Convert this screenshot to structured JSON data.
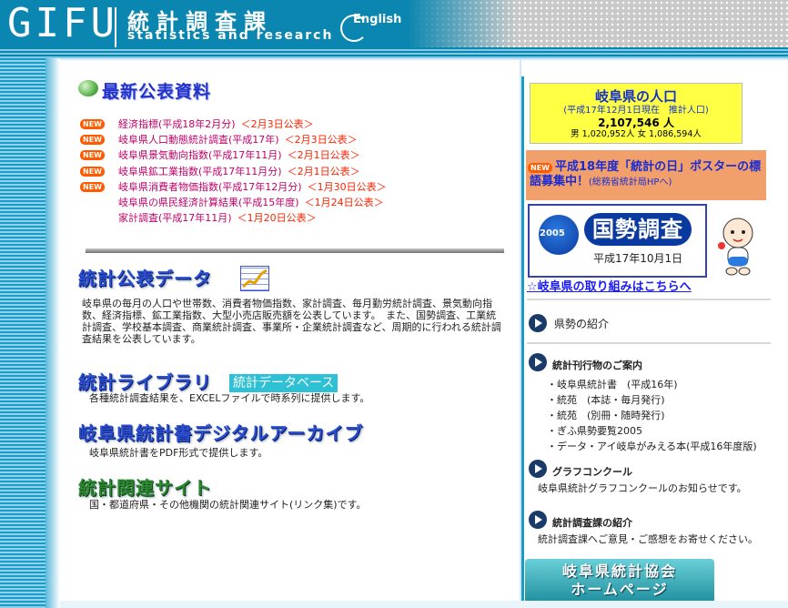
{
  "header": {
    "logo_gifu": "GIFU",
    "logo_jp": "統計調査課",
    "logo_en": "statistics and research",
    "english_label": "English"
  },
  "news": {
    "heading": "最新公表資料",
    "items": [
      {
        "badge": "NEW",
        "title": "経済指標(平成18年2月分)",
        "date": "＜2月3日公表＞"
      },
      {
        "badge": "NEW",
        "title": "岐阜県人口動態統計調査(平成17年)",
        "date": "＜2月3日公表＞"
      },
      {
        "badge": "NEW",
        "title": "岐阜県景気動向指数(平成17年11月)",
        "date": "＜2月1日公表＞"
      },
      {
        "badge": "NEW",
        "title": "岐阜県鉱工業指数(平成17年11月分)",
        "date": "＜2月1日公表＞"
      },
      {
        "badge": "NEW",
        "title": "岐阜県消費者物価指数(平成17年12月分)",
        "date": "＜1月30日公表＞"
      },
      {
        "badge": "",
        "title": "岐阜県の県民経済計算結果(平成15年度)",
        "date": "＜1月24日公表＞"
      },
      {
        "badge": "",
        "title": "家計調査(平成17年11月)",
        "date": "＜1月20日公表＞"
      }
    ]
  },
  "sections": {
    "stats": {
      "title": "統計公表データ",
      "text": "岐阜県の毎月の人口や世帯数、消費者物価指数、家計調査、毎月勤労統計調査、景気動向指数、経済指標、鉱工業指数、大型小売店販売額を公表しています。　また、国勢調査、工業統計調査、学校基本調査、商業統計調査、事業所・企業統計調査など、周期的に行われる統計調査結果を公表しています。"
    },
    "library": {
      "title": "統計ライブラリ",
      "db_label": "統計データベース",
      "text": "各種統計調査結果を、EXCELファイルで時系列に提供します。"
    },
    "archive": {
      "title": "岐阜県統計書デジタルアーカイブ",
      "text": "岐阜県統計書をPDF形式で提供します。"
    },
    "related": {
      "title": "統計関連サイト",
      "text": "国・都道府県・その他機関の統計関連サイト(リンク集)です。"
    }
  },
  "population": {
    "title": "岐阜県の人口",
    "date": "(平成17年12月1日現在　推計人口)",
    "total": "2,107,546 人",
    "breakdown": "男 1,020,952人 女 1,086,594人"
  },
  "poster": {
    "badge": "NEW",
    "text": "平成18年度「統計の日」ポスターの標語募集中！",
    "note": "(総務省統計局HPへ)"
  },
  "census": {
    "year": "2005",
    "label": "国勢調査",
    "date": "平成17年10月1日",
    "link": "☆岐阜県の取り組みはこちらへ"
  },
  "right_menu": {
    "prefecture": "県勢の紹介",
    "publications_head": "統計刊行物のご案内",
    "publications": [
      "・岐阜県統計書　(平成16年)",
      "・統苑　(本誌・毎月発行)",
      "・統苑　(別冊・随時発行)",
      "・ぎふ県勢要覧2005",
      "・データ・アイ岐阜がみえる本(平成16年度版)"
    ],
    "graph_head": "グラフコンクール",
    "graph_text": "岐阜県統計グラフコンクールのお知らせです。",
    "intro_head": "統計調査課の紹介",
    "intro_text": "統計調査課へご意見・ご感想をお寄せください。",
    "kyokai": "岐阜県統計協会\nホームページ"
  },
  "colors": {
    "header_blue": "#0a86b0",
    "news_link": "#c0006a",
    "news_date": "#ff2200",
    "section_blue": "#2b4fd0",
    "section_green": "#2d8a32",
    "population_bg": "#ffff44",
    "poster_bg": "#f2a06b"
  }
}
